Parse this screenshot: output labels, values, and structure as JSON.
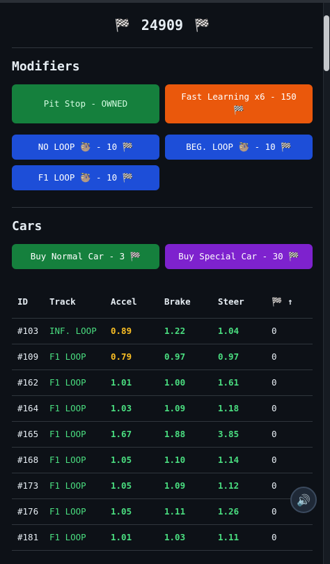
{
  "score": {
    "value": "24909",
    "flag_icon": "🏁"
  },
  "modifiers": {
    "title": "Modifiers",
    "items": [
      {
        "label": "Pit Stop - OWNED",
        "color": "#15803d"
      },
      {
        "label": "Fast Learning x6 - 150 🏁",
        "color": "#ea580c"
      },
      {
        "label": "NO LOOP 🦥 - 10 🏁",
        "color": "#1d4ed8"
      },
      {
        "label": "BEG. LOOP 🦥 - 10 🏁",
        "color": "#1d4ed8"
      },
      {
        "label": "F1 LOOP 🦥 - 10 🏁",
        "color": "#1d4ed8"
      }
    ]
  },
  "cars": {
    "title": "Cars",
    "buy_normal": "Buy Normal Car - 3 🏁",
    "buy_special": "Buy Special Car - 30 🏁"
  },
  "table": {
    "headers": [
      "ID",
      "Track",
      "Accel",
      "Brake",
      "Steer",
      "🏁 ↑"
    ],
    "rows": [
      {
        "id": "#103",
        "track": "INF. LOOP",
        "accel": "0.89",
        "brake": "1.22",
        "steer": "1.04",
        "flags": "0"
      },
      {
        "id": "#109",
        "track": "F1 LOOP",
        "accel": "0.79",
        "brake": "0.97",
        "steer": "0.97",
        "flags": "0"
      },
      {
        "id": "#162",
        "track": "F1 LOOP",
        "accel": "1.01",
        "brake": "1.00",
        "steer": "1.61",
        "flags": "0"
      },
      {
        "id": "#164",
        "track": "F1 LOOP",
        "accel": "1.03",
        "brake": "1.09",
        "steer": "1.18",
        "flags": "0"
      },
      {
        "id": "#165",
        "track": "F1 LOOP",
        "accel": "1.67",
        "brake": "1.88",
        "steer": "3.85",
        "flags": "0"
      },
      {
        "id": "#168",
        "track": "F1 LOOP",
        "accel": "1.05",
        "brake": "1.10",
        "steer": "1.14",
        "flags": "0"
      },
      {
        "id": "#173",
        "track": "F1 LOOP",
        "accel": "1.05",
        "brake": "1.09",
        "steer": "1.12",
        "flags": "0"
      },
      {
        "id": "#176",
        "track": "F1 LOOP",
        "accel": "1.05",
        "brake": "1.11",
        "steer": "1.26",
        "flags": "0"
      },
      {
        "id": "#181",
        "track": "F1 LOOP",
        "accel": "1.01",
        "brake": "1.03",
        "steer": "1.11",
        "flags": "0"
      }
    ]
  },
  "sound_icon": "🔊"
}
